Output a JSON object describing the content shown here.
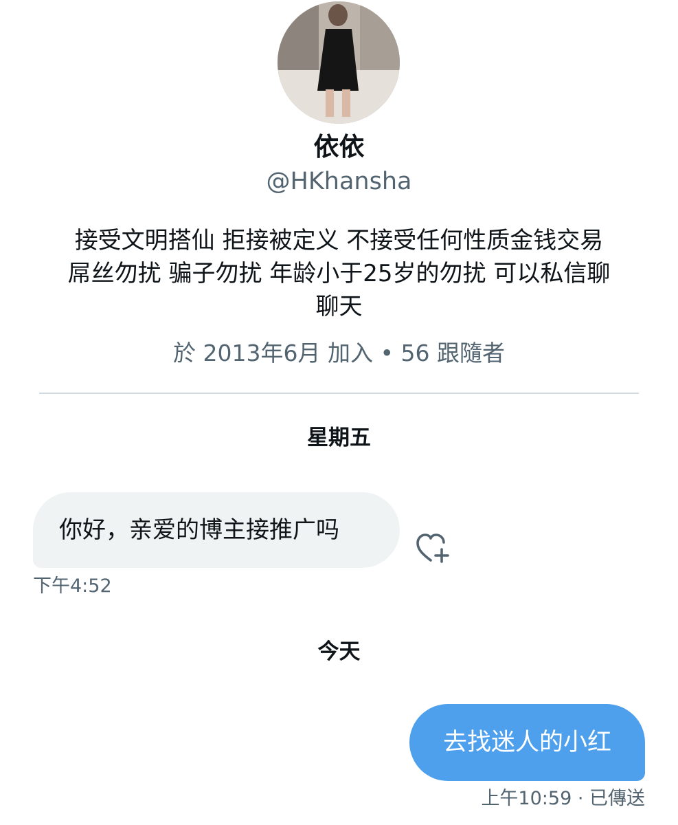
{
  "profile": {
    "display_name": "依依",
    "handle": "@HKhansha",
    "bio_lines": [
      "接受文明搭仙 拒接被定义 不接受任何性质金钱交易",
      "屌丝勿扰 骗子勿扰 年龄小于25岁的勿扰 可以私信聊",
      "聊天"
    ],
    "joined": "於 2013年6月 加入",
    "separator": " • ",
    "followers": "56 跟隨者"
  },
  "conversation": {
    "day_1": "星期五",
    "message_in": {
      "text": "你好，亲爱的博主接推广吗",
      "time": "下午4:52",
      "react_icon": "heart-plus-icon"
    },
    "day_2": "今天",
    "message_out": {
      "text": "去找迷人的小红",
      "time": "上午10:59",
      "status_separator": " · ",
      "status": "已傳送"
    }
  },
  "colors": {
    "primary_text": "#0f1419",
    "secondary_text": "#536471",
    "incoming_bubble": "#eff3f4",
    "outgoing_bubble": "#4e9fec",
    "divider": "#cfd9de"
  }
}
